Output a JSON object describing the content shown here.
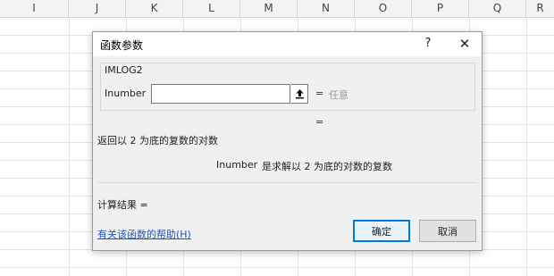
{
  "spreadsheet": {
    "columns": [
      "I",
      "J",
      "K",
      "L",
      "M",
      "N",
      "O",
      "P",
      "Q",
      "R"
    ]
  },
  "dialog": {
    "title": "函数参数",
    "help_icon": "question-mark",
    "close_icon": "x-close",
    "function_name": "IMLOG2",
    "argument": {
      "label": "Inumber",
      "value": "",
      "equals": "=",
      "hint": "任意"
    },
    "formula_equals": "=",
    "function_description": "返回以 2 为底的复数的对数",
    "argument_description": {
      "name": "Inumber",
      "text": "是求解以 2 为底的对数的复数"
    },
    "result_label": "计算结果 =",
    "help_link": "有关该函数的帮助(H)",
    "ok_label": "确定",
    "cancel_label": "取消"
  }
}
